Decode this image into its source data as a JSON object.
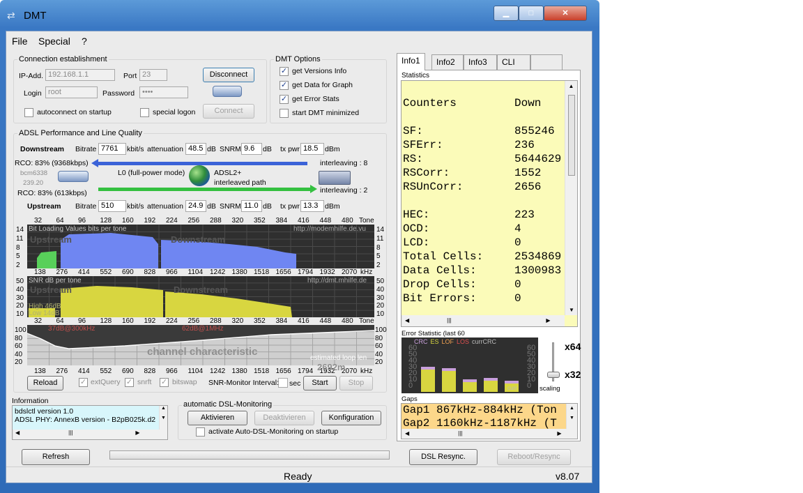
{
  "window": {
    "title": "DMT",
    "minimize_label": "▁",
    "maximize_label": "□",
    "close_label": "✕"
  },
  "menu": [
    "File",
    "Special",
    "?"
  ],
  "connection": {
    "group_label": "Connection establishment",
    "ip_label": "IP-Add.",
    "ip_value": "192.168.1.1",
    "port_label": "Port",
    "port_value": "23",
    "login_label": "Login",
    "login_value": "root",
    "password_label": "Password",
    "password_value": "••••",
    "disconnect": "Disconnect",
    "connect": "Connect",
    "autoconnect": "autoconnect on startup",
    "special_logon": "special logon"
  },
  "options": {
    "group_label": "DMT Options",
    "items": [
      {
        "label": "get Versions Info",
        "checked": true
      },
      {
        "label": "get Data for Graph",
        "checked": true
      },
      {
        "label": "get Error Stats",
        "checked": true
      },
      {
        "label": "start DMT minimized",
        "checked": false
      }
    ]
  },
  "performance": {
    "group_label": "ADSL Performance and Line Quality",
    "downstream": {
      "label": "Downstream",
      "bitrate_label": "Bitrate",
      "bitrate": "7761",
      "bitrate_unit": "kbit/s",
      "att_label": "attenuation",
      "att": "48.5",
      "att_unit": "dB",
      "snrm_label": "SNRM",
      "snrm": "9.6",
      "snrm_unit": "dB",
      "txpwr_label": "tx pwr",
      "txpwr": "18.5",
      "txpwr_unit": "dBm"
    },
    "upstream": {
      "label": "Upstream",
      "bitrate_label": "Bitrate",
      "bitrate": "510",
      "bitrate_unit": "kbit/s",
      "att_label": "attenuation",
      "att": "24.9",
      "att_unit": "dB",
      "snrm_label": "SNRM",
      "snrm": "11.0",
      "snrm_unit": "dB",
      "txpwr_label": "tx pwr",
      "txpwr": "13.3",
      "txpwr_unit": "dBm"
    },
    "rco_down": "RCO: 83% (9368kbps)",
    "rco_up": "RCO: 83% (613kbps)",
    "modem": "bcm6338",
    "modem_ver": "239.20",
    "mode": "L0 (full-power mode)",
    "adsl_mode": "ADSL2+",
    "path": "interleaved path",
    "interleave_down": "interleaving : 8",
    "interleave_up": "interleaving : 2"
  },
  "graphs": {
    "tones": [
      "32",
      "64",
      "96",
      "128",
      "160",
      "192",
      "224",
      "256",
      "288",
      "320",
      "352",
      "384",
      "416",
      "448",
      "480",
      "Tone"
    ],
    "khz": [
      "138",
      "276",
      "414",
      "552",
      "690",
      "828",
      "966",
      "1104",
      "1242",
      "1380",
      "1518",
      "1656",
      "1794",
      "1932",
      "2070",
      "kHz"
    ],
    "bits": {
      "title": "Bit Loading Values  bits per tone",
      "url": "http://modemhilfe.de.vu",
      "up": "Upstream",
      "down": "Downstream",
      "yticks": [
        "14",
        "11",
        "8",
        "5",
        "2"
      ]
    },
    "snr": {
      "title": "SNR  dB per tone",
      "url": "http://dmt.mhilfe.de",
      "up": "Upstream",
      "down": "Downstream",
      "yticks": [
        "50",
        "40",
        "30",
        "20",
        "10"
      ],
      "high": "High 46dB",
      "low": "Low 14dB"
    },
    "channel": {
      "anno1": "37dB@300kHz",
      "anno2": "62dB@1MHz",
      "title": "channel characteristic",
      "est": "estimated loop len",
      "est_val": "2692m",
      "yticks": [
        "100",
        "80",
        "60",
        "40",
        "20"
      ]
    }
  },
  "graph_controls": {
    "reload": "Reload",
    "extquery": "extQuery",
    "snrft": "snrft",
    "bitswap": "bitswap",
    "snr_interval": "SNR-Monitor Interval:",
    "sec": "sec",
    "start": "Start",
    "stop": "Stop"
  },
  "information": {
    "label": "Information",
    "lines": [
      "bdslctl version 1.0",
      "ADSL PHY: AnnexB version - B2pB025k.d2"
    ]
  },
  "monitoring": {
    "label": "automatic DSL-Monitoring",
    "activate": "Aktivieren",
    "deactivate": "Deaktivieren",
    "config": "Konfiguration",
    "startup": "activate Auto-DSL-Monitoring on startup"
  },
  "bottom": {
    "refresh": "Refresh",
    "resync": "DSL Resync.",
    "reboot": "Reboot/Resync"
  },
  "status": {
    "text": "Ready",
    "version": "v8.07"
  },
  "tabs": [
    "Info1",
    "Info2",
    "Info3",
    "CLI",
    ""
  ],
  "statistics": {
    "label": "Statistics",
    "rows": [
      [
        "Counters",
        "Down"
      ],
      [
        "",
        ""
      ],
      [
        "SF:",
        "855246"
      ],
      [
        "SFErr:",
        "236"
      ],
      [
        "RS:",
        "5644629"
      ],
      [
        "RSCorr:",
        "1552"
      ],
      [
        "RSUnCorr:",
        "2656"
      ],
      [
        "",
        ""
      ],
      [
        "HEC:",
        "223"
      ],
      [
        "OCD:",
        "4"
      ],
      [
        "LCD:",
        "0"
      ],
      [
        "Total Cells:",
        "2534869"
      ],
      [
        "Data Cells:",
        "1300983"
      ],
      [
        "Drop Cells:",
        "0"
      ],
      [
        "Bit Errors:",
        "0"
      ]
    ]
  },
  "error_stat": {
    "label": "Error Statistic (last 60",
    "legend": [
      "CRC",
      "ES",
      "LOF",
      "LOS",
      "currCRC"
    ],
    "yticks": [
      "60",
      "50",
      "40",
      "30",
      "20",
      "10",
      "0"
    ],
    "scale_top": "x64",
    "scale_bottom": "x32",
    "scaling": "scaling",
    "curr": "curr"
  },
  "gaps": {
    "label": "Gaps",
    "line1": "Gap1 867kHz-884kHz (Ton",
    "line2": "Gap2 1160kHz-1187kHz (T"
  },
  "colors": {
    "upstream": "#58d05a",
    "downstream": "#6f86f2",
    "snr": "#d8d640",
    "chart_bg": "#2f2f2f",
    "stats_bg": "#fbfbb9"
  }
}
